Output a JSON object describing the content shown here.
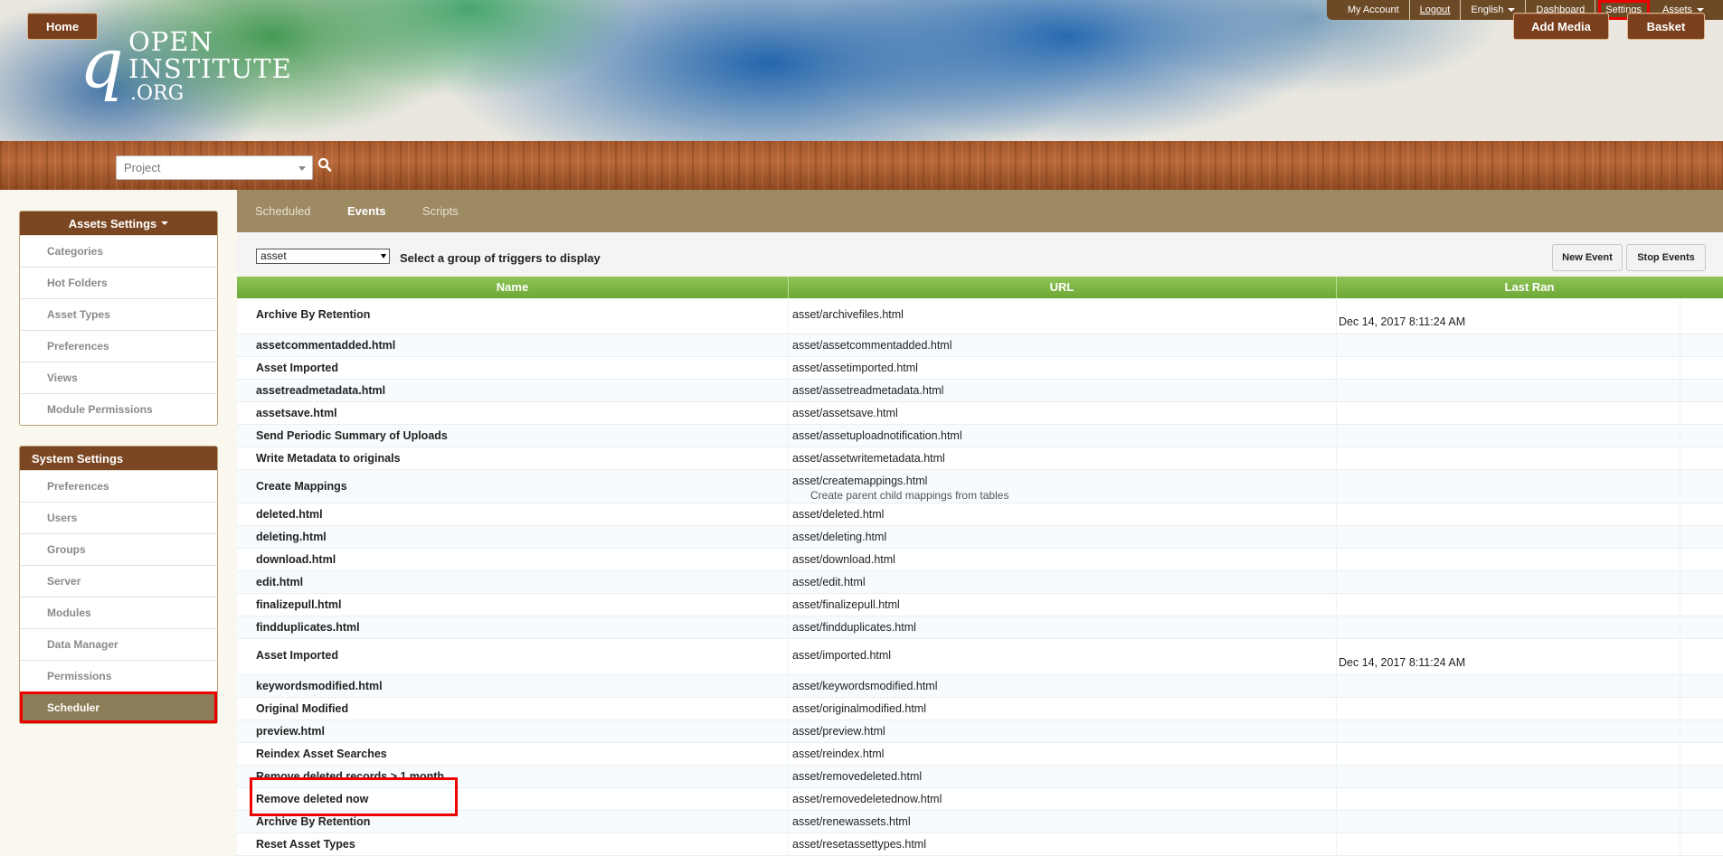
{
  "logo": {
    "mark": "q",
    "line1": "OPEN",
    "line2": "INSTITUTE",
    "line3": ".ORG"
  },
  "toplinks": [
    {
      "label": "My Account"
    },
    {
      "label": "Logout"
    },
    {
      "label": "English"
    },
    {
      "label": "Dashboard"
    },
    {
      "label": "Settings"
    },
    {
      "label": "Assets"
    }
  ],
  "nav": {
    "home": "Home",
    "project_placeholder": "Project",
    "add_media": "Add Media",
    "basket": "Basket"
  },
  "sidebar": {
    "assets_title": "Assets Settings",
    "assets_items": [
      "Categories",
      "Hot Folders",
      "Asset Types",
      "Preferences",
      "Views",
      "Module Permissions"
    ],
    "system_title": "System Settings",
    "system_items": [
      "Preferences",
      "Users",
      "Groups",
      "Server",
      "Modules",
      "Data Manager",
      "Permissions",
      "Scheduler"
    ]
  },
  "tabs": [
    "Scheduled",
    "Events",
    "Scripts"
  ],
  "toolbar": {
    "select_value": "asset",
    "select_label": "Select a group of triggers to display",
    "new_event": "New Event",
    "stop_events": "Stop Events"
  },
  "table": {
    "headers": [
      "Name",
      "URL",
      "Last Ran"
    ],
    "rows": [
      {
        "name": "Archive By Retention",
        "url": "asset/archivefiles.html",
        "desc": "",
        "last": "Dec 14, 2017 8:11:24 AM"
      },
      {
        "name": "assetcommentadded.html",
        "url": "asset/assetcommentadded.html",
        "desc": "",
        "last": ""
      },
      {
        "name": "Asset Imported",
        "url": "asset/assetimported.html",
        "desc": "",
        "last": ""
      },
      {
        "name": "assetreadmetadata.html",
        "url": "asset/assetreadmetadata.html",
        "desc": "",
        "last": ""
      },
      {
        "name": "assetsave.html",
        "url": "asset/assetsave.html",
        "desc": "",
        "last": ""
      },
      {
        "name": "Send Periodic Summary of Uploads",
        "url": "asset/assetuploadnotification.html",
        "desc": "",
        "last": ""
      },
      {
        "name": "Write Metadata to originals",
        "url": "asset/assetwritemetadata.html",
        "desc": "",
        "last": ""
      },
      {
        "name": "Create Mappings",
        "url": "asset/createmappings.html",
        "desc": "Create parent child mappings from tables",
        "last": ""
      },
      {
        "name": "deleted.html",
        "url": "asset/deleted.html",
        "desc": "",
        "last": ""
      },
      {
        "name": "deleting.html",
        "url": "asset/deleting.html",
        "desc": "",
        "last": ""
      },
      {
        "name": "download.html",
        "url": "asset/download.html",
        "desc": "",
        "last": ""
      },
      {
        "name": "edit.html",
        "url": "asset/edit.html",
        "desc": "",
        "last": ""
      },
      {
        "name": "finalizepull.html",
        "url": "asset/finalizepull.html",
        "desc": "",
        "last": ""
      },
      {
        "name": "findduplicates.html",
        "url": "asset/findduplicates.html",
        "desc": "",
        "last": ""
      },
      {
        "name": "Asset Imported",
        "url": "asset/imported.html",
        "desc": "",
        "last": "Dec 14, 2017 8:11:24 AM"
      },
      {
        "name": "keywordsmodified.html",
        "url": "asset/keywordsmodified.html",
        "desc": "",
        "last": ""
      },
      {
        "name": "Original Modified",
        "url": "asset/originalmodified.html",
        "desc": "",
        "last": ""
      },
      {
        "name": "preview.html",
        "url": "asset/preview.html",
        "desc": "",
        "last": ""
      },
      {
        "name": "Reindex Asset Searches",
        "url": "asset/reindex.html",
        "desc": "",
        "last": ""
      },
      {
        "name": "Remove deleted records > 1 month",
        "url": "asset/removedeleted.html",
        "desc": "",
        "last": ""
      },
      {
        "name": "Remove deleted now",
        "url": "asset/removedeletednow.html",
        "desc": "",
        "last": ""
      },
      {
        "name": "Archive By Retention",
        "url": "asset/renewassets.html",
        "desc": "",
        "last": ""
      },
      {
        "name": "Reset Asset Types",
        "url": "asset/resetassettypes.html",
        "desc": "",
        "last": ""
      }
    ]
  }
}
